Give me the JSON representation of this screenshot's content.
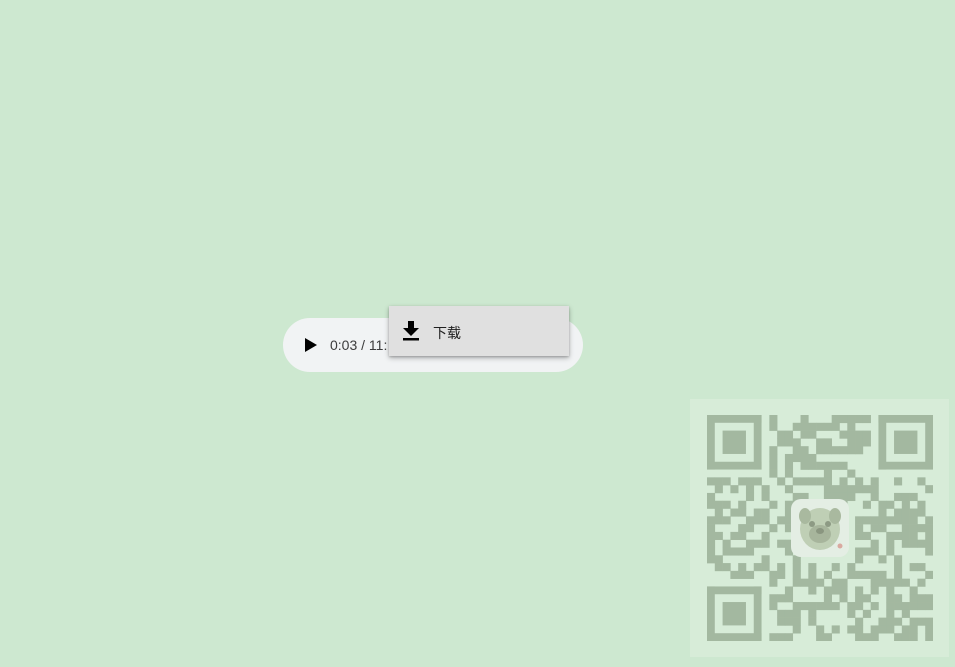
{
  "player": {
    "time_display": "0:03 / 11:",
    "play_icon": "play-icon",
    "background_color": "#f1f3f4"
  },
  "context_menu": {
    "items": [
      {
        "label": "下载",
        "icon": "download-icon"
      }
    ],
    "background_color": "#e0e0e0"
  },
  "qr": {
    "icon": "qr-code-icon",
    "logo": "pug-avatar-icon"
  },
  "page": {
    "background_color": "#cde8d0"
  }
}
